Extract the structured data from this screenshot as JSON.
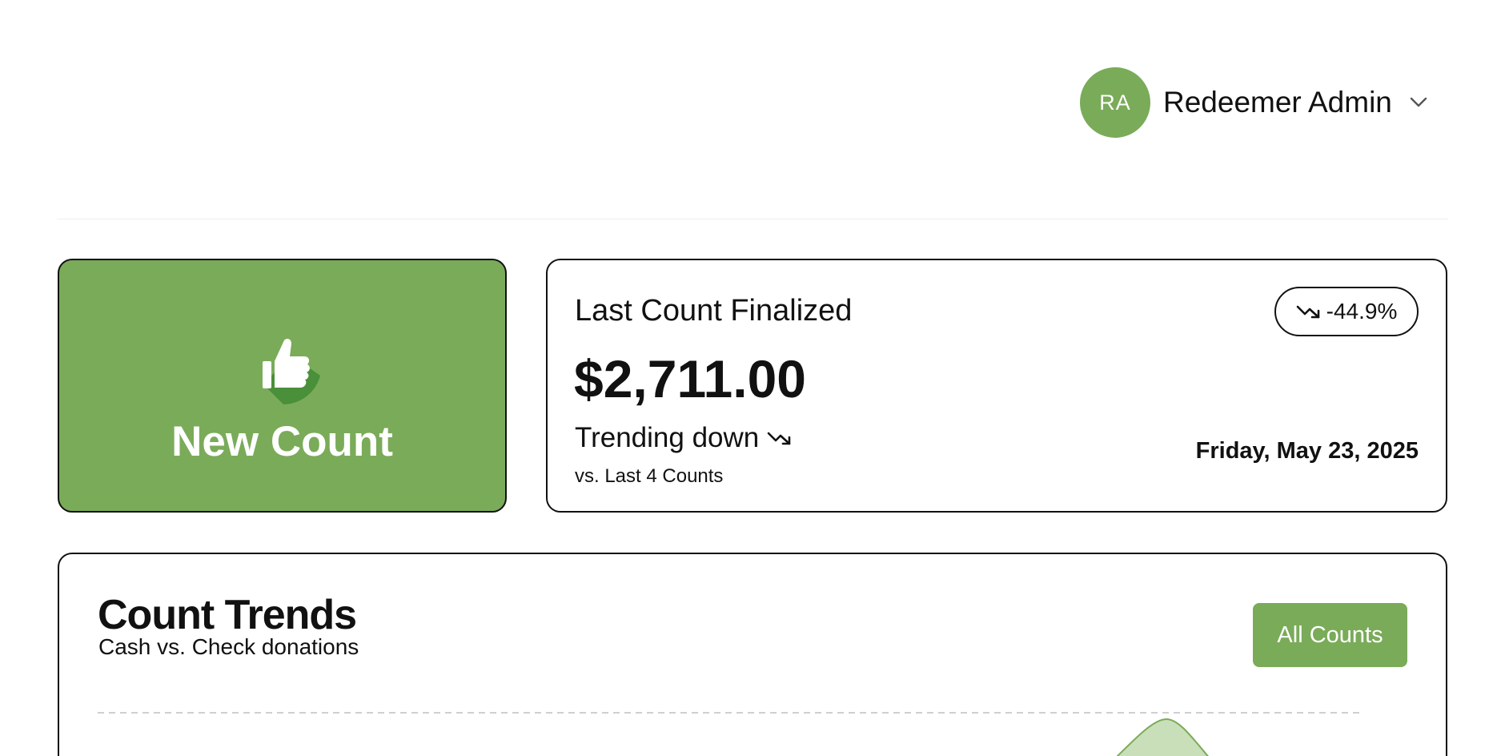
{
  "header": {
    "user": {
      "initials": "RA",
      "name": "Redeemer Admin"
    }
  },
  "new_count": {
    "label": "New Count"
  },
  "last_count": {
    "title": "Last Count Finalized",
    "amount": "$2,711.00",
    "trend_label": "Trending down",
    "trend_sub": "vs. Last 4 Counts",
    "change_badge": "-44.9%",
    "date": "Friday, May 23, 2025"
  },
  "trends": {
    "title": "Count Trends",
    "subtitle": "Cash vs. Check donations",
    "all_counts_label": "All Counts"
  },
  "colors": {
    "accent": "#7aab59",
    "accent_dark": "#4a8f3a",
    "chart_fill": "#c9dfb9"
  }
}
